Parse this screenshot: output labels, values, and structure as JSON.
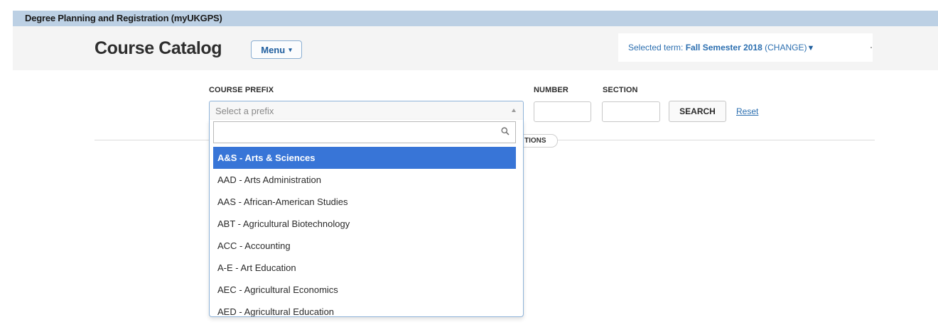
{
  "app": {
    "title": "Degree Planning and Registration (myUKGPS)"
  },
  "header": {
    "page_title": "Course Catalog",
    "menu_label": "Menu",
    "term_prefix": "Selected term:",
    "term_value": "Fall Semester 2018",
    "term_change": "(CHANGE)",
    "term_arrow_icon": "triangle-down-icon"
  },
  "form": {
    "prefix_label": "COURSE PREFIX",
    "prefix_placeholder": "Select a prefix",
    "number_label": "NUMBER",
    "section_label": "SECTION",
    "search_label": "SEARCH",
    "reset_label": "Reset",
    "options_partial_label": "TIONS"
  },
  "dropdown": {
    "search_value": "",
    "selected_index": 0,
    "items": [
      "A&S - Arts & Sciences",
      "AAD - Arts Administration",
      "AAS - African-American Studies",
      "ABT - Agricultural Biotechnology",
      "ACC - Accounting",
      "A-E - Art Education",
      "AEC - Agricultural Economics",
      "AED - Agricultural Education"
    ]
  },
  "colors": {
    "header_band": "#bcd0e4",
    "link": "#2c6fb0",
    "selected_row": "#3875d7"
  }
}
